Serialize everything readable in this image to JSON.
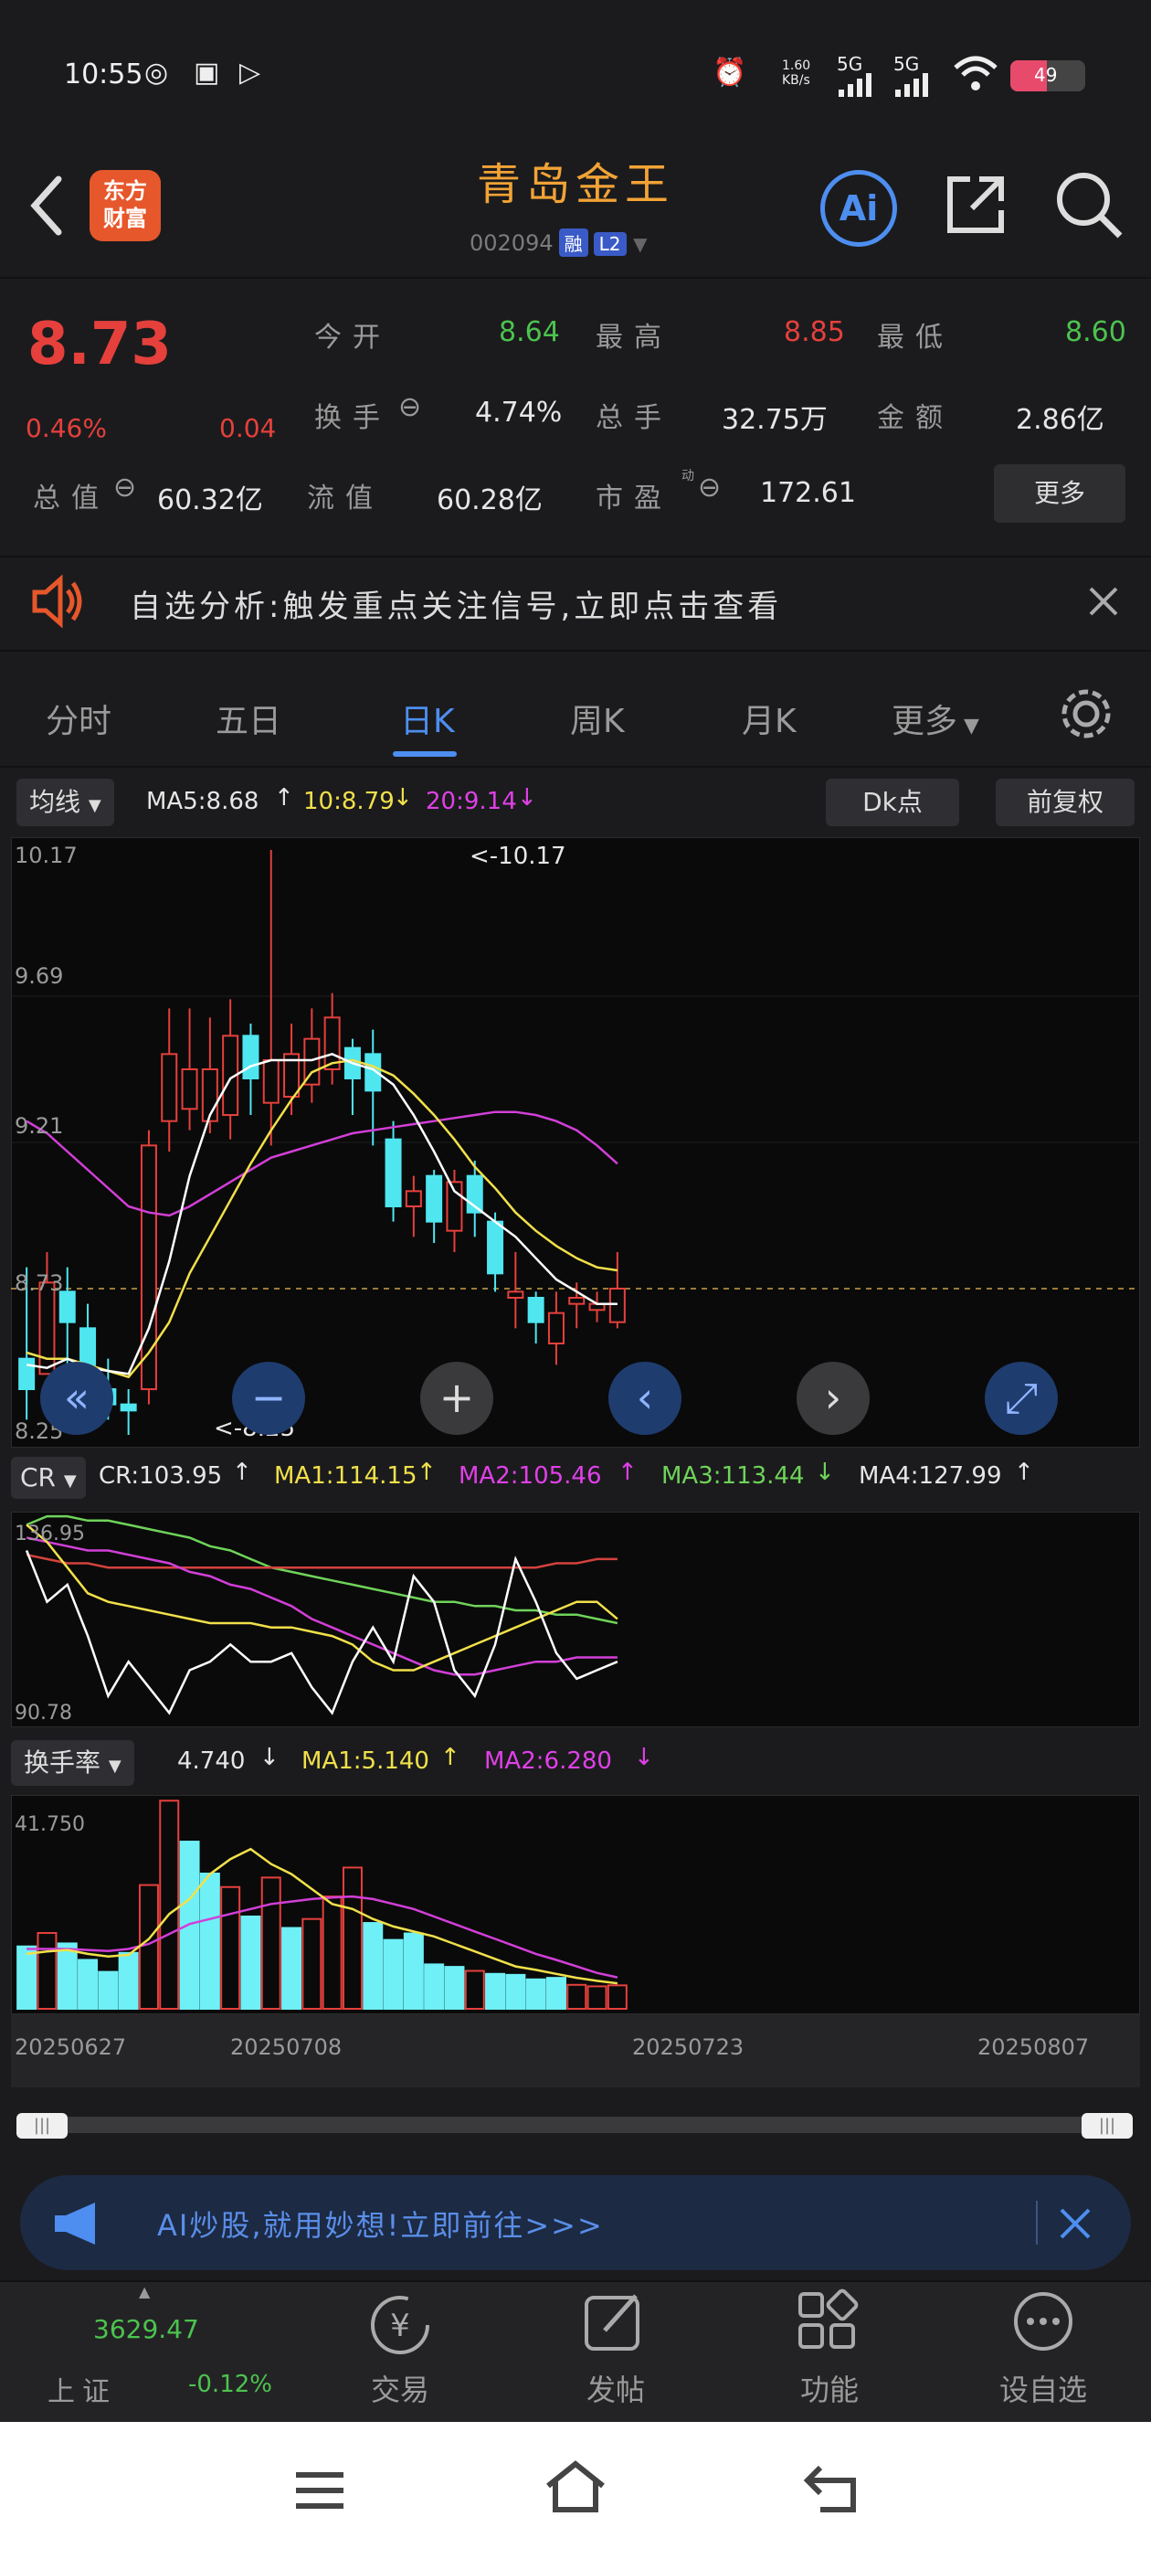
{
  "status_bar": {
    "time": "10:55",
    "net_speed": "1.60 KB/s",
    "battery": "49",
    "signal1": "5G",
    "signal2": "5G"
  },
  "header": {
    "logo_line1": "东方",
    "logo_line2": "财富",
    "stock_name": "青岛金王",
    "stock_code": "002094",
    "tag_margin": "融",
    "tag_level": "L2",
    "ai_label": "Ai"
  },
  "quote": {
    "price": "8.73",
    "change_pct": "0.46%",
    "change": "0.04",
    "open_label": "今开",
    "open": "8.64",
    "high_label": "最高",
    "high": "8.85",
    "low_label": "最低",
    "low": "8.60",
    "turnover_label": "换手",
    "turnover": "4.74%",
    "volume_label": "总手",
    "volume": "32.75万",
    "amount_label": "金额",
    "amount": "2.86亿",
    "mktcap_label": "总值",
    "mktcap": "60.32亿",
    "float_label": "流值",
    "float": "60.28亿",
    "pe_label": "市盈",
    "pe_sup": "动",
    "pe": "172.61",
    "more_label": "更多"
  },
  "alert": {
    "text": "自选分析:触发重点关注信号,立即点击查看"
  },
  "tabs": [
    {
      "label": "分时"
    },
    {
      "label": "五日"
    },
    {
      "label": "日K"
    },
    {
      "label": "周K"
    },
    {
      "label": "月K"
    },
    {
      "label": "更多"
    }
  ],
  "ma_bar": {
    "selector": "均线",
    "ma5": "MA5:8.68",
    "ma10": "10:8.79",
    "ma20": "20:9.14",
    "dk_label": "Dk点",
    "adj_label": "前复权"
  },
  "kline": {
    "y_top": "10.17",
    "y_mid1": "9.69",
    "y_mid2": "9.21",
    "y_mid3": "8.73",
    "y_bottom": "8.25",
    "high_note": "<-10.17",
    "low_note": "<-8.25"
  },
  "cr_bar": {
    "selector": "CR",
    "cr": "CR:103.95",
    "ma1": "MA1:114.15",
    "ma2": "MA2:105.46",
    "ma3": "MA3:113.44",
    "ma4": "MA4:127.99",
    "y_top": "136.95",
    "y_bottom": "90.78"
  },
  "turn_bar": {
    "selector": "换手率",
    "value": "4.740",
    "ma1": "MA1:5.140",
    "ma2": "MA2:6.280",
    "y_top": "41.750"
  },
  "dates": [
    "20250627",
    "20250708",
    "20250723",
    "20250807"
  ],
  "ai_banner": {
    "text": "AI炒股,就用妙想!立即前往>>>"
  },
  "bottom_nav": {
    "index_value": "3629.47",
    "index_name": "上证",
    "index_change": "-0.12%",
    "trade": "交易",
    "post": "发帖",
    "func": "功能",
    "watch": "设自选"
  },
  "chart_data": {
    "type": "candlestick",
    "x_first": "20250627",
    "x_last": "20250807",
    "ylim": [
      8.25,
      10.17
    ],
    "candles": [
      {
        "o": 8.4,
        "h": 8.8,
        "l": 8.3,
        "c": 8.5,
        "up": false
      },
      {
        "o": 8.75,
        "h": 8.85,
        "l": 8.45,
        "c": 8.45,
        "up": true
      },
      {
        "o": 8.72,
        "h": 8.8,
        "l": 8.4,
        "c": 8.62,
        "up": false
      },
      {
        "o": 8.6,
        "h": 8.68,
        "l": 8.42,
        "c": 8.48,
        "up": false
      },
      {
        "o": 8.4,
        "h": 8.5,
        "l": 8.3,
        "c": 8.35,
        "up": false
      },
      {
        "o": 8.35,
        "h": 8.4,
        "l": 8.25,
        "c": 8.33,
        "up": false
      },
      {
        "o": 8.4,
        "h": 9.25,
        "l": 8.35,
        "c": 9.2,
        "up": true
      },
      {
        "o": 9.28,
        "h": 9.65,
        "l": 9.18,
        "c": 9.5,
        "up": true
      },
      {
        "o": 9.32,
        "h": 9.65,
        "l": 9.25,
        "c": 9.45,
        "up": true
      },
      {
        "o": 9.28,
        "h": 9.62,
        "l": 9.24,
        "c": 9.45,
        "up": true
      },
      {
        "o": 9.3,
        "h": 9.68,
        "l": 9.22,
        "c": 9.56,
        "up": true
      },
      {
        "o": 9.56,
        "h": 9.6,
        "l": 9.3,
        "c": 9.42,
        "up": false
      },
      {
        "o": 9.34,
        "h": 10.17,
        "l": 9.2,
        "c": 9.48,
        "up": true
      },
      {
        "o": 9.36,
        "h": 9.6,
        "l": 9.3,
        "c": 9.5,
        "up": true
      },
      {
        "o": 9.4,
        "h": 9.65,
        "l": 9.34,
        "c": 9.55,
        "up": true
      },
      {
        "o": 9.45,
        "h": 9.7,
        "l": 9.4,
        "c": 9.62,
        "up": true
      },
      {
        "o": 9.52,
        "h": 9.55,
        "l": 9.3,
        "c": 9.42,
        "up": false
      },
      {
        "o": 9.5,
        "h": 9.58,
        "l": 9.2,
        "c": 9.38,
        "up": false
      },
      {
        "o": 9.22,
        "h": 9.28,
        "l": 8.95,
        "c": 9.0,
        "up": false
      },
      {
        "o": 9.05,
        "h": 9.1,
        "l": 8.9,
        "c": 9.0,
        "up": true
      },
      {
        "o": 9.1,
        "h": 9.12,
        "l": 8.88,
        "c": 8.95,
        "up": false
      },
      {
        "o": 8.92,
        "h": 9.12,
        "l": 8.85,
        "c": 9.08,
        "up": true
      },
      {
        "o": 9.1,
        "h": 9.15,
        "l": 8.9,
        "c": 8.98,
        "up": false
      },
      {
        "o": 8.95,
        "h": 8.98,
        "l": 8.72,
        "c": 8.78,
        "up": false
      },
      {
        "o": 8.7,
        "h": 8.85,
        "l": 8.6,
        "c": 8.72,
        "up": true
      },
      {
        "o": 8.7,
        "h": 8.72,
        "l": 8.55,
        "c": 8.62,
        "up": false
      },
      {
        "o": 8.55,
        "h": 8.72,
        "l": 8.48,
        "c": 8.65,
        "up": true
      },
      {
        "o": 8.7,
        "h": 8.75,
        "l": 8.6,
        "c": 8.68,
        "up": true
      },
      {
        "o": 8.68,
        "h": 8.72,
        "l": 8.62,
        "c": 8.66,
        "up": true
      },
      {
        "o": 8.62,
        "h": 8.85,
        "l": 8.6,
        "c": 8.73,
        "up": true
      }
    ],
    "ma5": [
      8.48,
      8.47,
      8.5,
      8.47,
      8.46,
      8.45,
      8.6,
      8.82,
      9.1,
      9.3,
      9.42,
      9.46,
      9.48,
      9.48,
      9.48,
      9.5,
      9.47,
      9.45,
      9.4,
      9.3,
      9.18,
      9.05,
      9.0,
      8.95,
      8.9,
      8.83,
      8.76,
      8.72,
      8.68,
      8.68
    ],
    "ma10": [
      8.52,
      8.5,
      8.5,
      8.48,
      8.46,
      8.44,
      8.52,
      8.62,
      8.78,
      8.9,
      9.02,
      9.14,
      9.25,
      9.35,
      9.44,
      9.47,
      9.48,
      9.46,
      9.43,
      9.37,
      9.3,
      9.22,
      9.13,
      9.06,
      8.98,
      8.92,
      8.87,
      8.83,
      8.8,
      8.79
    ],
    "ma20": [
      9.28,
      9.24,
      9.18,
      9.12,
      9.06,
      9.0,
      8.98,
      8.97,
      9.0,
      9.04,
      9.08,
      9.12,
      9.16,
      9.18,
      9.2,
      9.22,
      9.24,
      9.25,
      9.26,
      9.27,
      9.28,
      9.29,
      9.3,
      9.31,
      9.31,
      9.3,
      9.28,
      9.25,
      9.2,
      9.14
    ],
    "cr_series": {
      "ylim": [
        90.78,
        136.95
      ],
      "cr": [
        130,
        118,
        122,
        110,
        96,
        104,
        98,
        92,
        102,
        104,
        108,
        104,
        104,
        106,
        98,
        92,
        104,
        112,
        104,
        124,
        118,
        102,
        96,
        108,
        128,
        118,
        106,
        100,
        102,
        104
      ],
      "ma1": [
        136,
        132,
        126,
        120,
        118,
        117,
        116,
        115,
        114,
        113,
        113,
        113,
        112,
        112,
        111,
        110,
        108,
        104,
        102,
        102,
        104,
        106,
        108,
        110,
        112,
        114,
        116,
        118,
        118,
        114
      ],
      "ma2": [
        133,
        132,
        131,
        130,
        130,
        129,
        128,
        127,
        125,
        124,
        122,
        121,
        119,
        117,
        114,
        112,
        110,
        108,
        106,
        104,
        102,
        101,
        101,
        102,
        103,
        104,
        104,
        105,
        105,
        105
      ],
      "ma3": [
        136,
        138,
        138,
        137,
        137,
        136,
        135,
        134,
        133,
        131,
        130,
        128,
        126,
        125,
        124,
        123,
        122,
        121,
        120,
        119,
        118,
        118,
        117,
        117,
        116,
        116,
        115,
        115,
        114,
        113
      ],
      "ma4": [
        129,
        128,
        127,
        127,
        126,
        126,
        126,
        126,
        126,
        126,
        126,
        126,
        126,
        126,
        126,
        126,
        126,
        126,
        126,
        126,
        126,
        126,
        126,
        126,
        126,
        126,
        127,
        127,
        128,
        128
      ]
    },
    "turnover_series": {
      "ylim": [
        0,
        41.75
      ],
      "values": [
        12.5,
        15.2,
        13.1,
        9.8,
        7.4,
        11.2,
        24.8,
        41.7,
        33.5,
        27.1,
        24.4,
        18.5,
        26.3,
        16.2,
        18.0,
        22.5,
        28.3,
        17.2,
        13.8,
        15.1,
        8.9,
        8.4,
        7.6,
        7.0,
        6.8,
        5.9,
        6.2,
        4.8,
        4.5,
        4.7
      ],
      "up": [
        false,
        true,
        false,
        false,
        false,
        false,
        true,
        true,
        false,
        false,
        true,
        false,
        true,
        false,
        true,
        true,
        true,
        false,
        false,
        false,
        false,
        false,
        true,
        false,
        false,
        false,
        false,
        true,
        true,
        true
      ],
      "ma1": [
        11,
        11.5,
        11.8,
        11,
        10.5,
        10.8,
        14,
        19,
        22,
        27,
        30,
        32,
        29,
        27,
        24,
        21,
        20,
        18,
        16.5,
        15.5,
        14.5,
        13,
        11.5,
        10,
        8.5,
        7.8,
        7,
        6.2,
        5.6,
        5.1
      ],
      "ma2": [
        12,
        12,
        12,
        11.8,
        11.6,
        12,
        13,
        15,
        17,
        18,
        19,
        20,
        21,
        21.5,
        22,
        22.3,
        22.5,
        22,
        21,
        20,
        18.5,
        17,
        15.5,
        14,
        12.5,
        11,
        9.8,
        8.5,
        7.2,
        6.3
      ]
    }
  }
}
